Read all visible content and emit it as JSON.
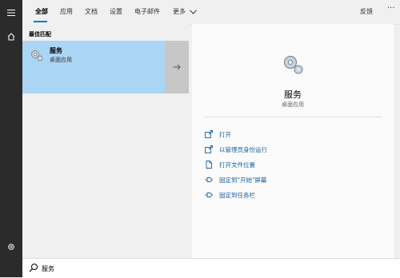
{
  "tabs": [
    {
      "label": "全部"
    },
    {
      "label": "应用"
    },
    {
      "label": "文档"
    },
    {
      "label": "设置"
    },
    {
      "label": "电子邮件"
    },
    {
      "label": "更多"
    }
  ],
  "feedback_label": "反馈",
  "more_options_label": "···",
  "best_match": {
    "section_label": "最佳匹配",
    "title": "服务",
    "subtitle": "桌面应用"
  },
  "detail": {
    "title": "服务",
    "subtitle": "桌面应用",
    "actions": [
      {
        "label": "打开",
        "icon": "open-icon"
      },
      {
        "label": "以管理员身份运行",
        "icon": "run-as-admin-icon"
      },
      {
        "label": "打开文件位置",
        "icon": "file-location-icon"
      },
      {
        "label": "固定到\"开始\"屏幕",
        "icon": "pin-icon"
      },
      {
        "label": "固定到任务栏",
        "icon": "pin-icon"
      }
    ]
  },
  "search": {
    "value": "服务"
  },
  "colors": {
    "accent": "#0078d7",
    "selected_bg": "#abd5f5",
    "rail_bg": "#2b2b2b",
    "link": "#1a5f99"
  }
}
